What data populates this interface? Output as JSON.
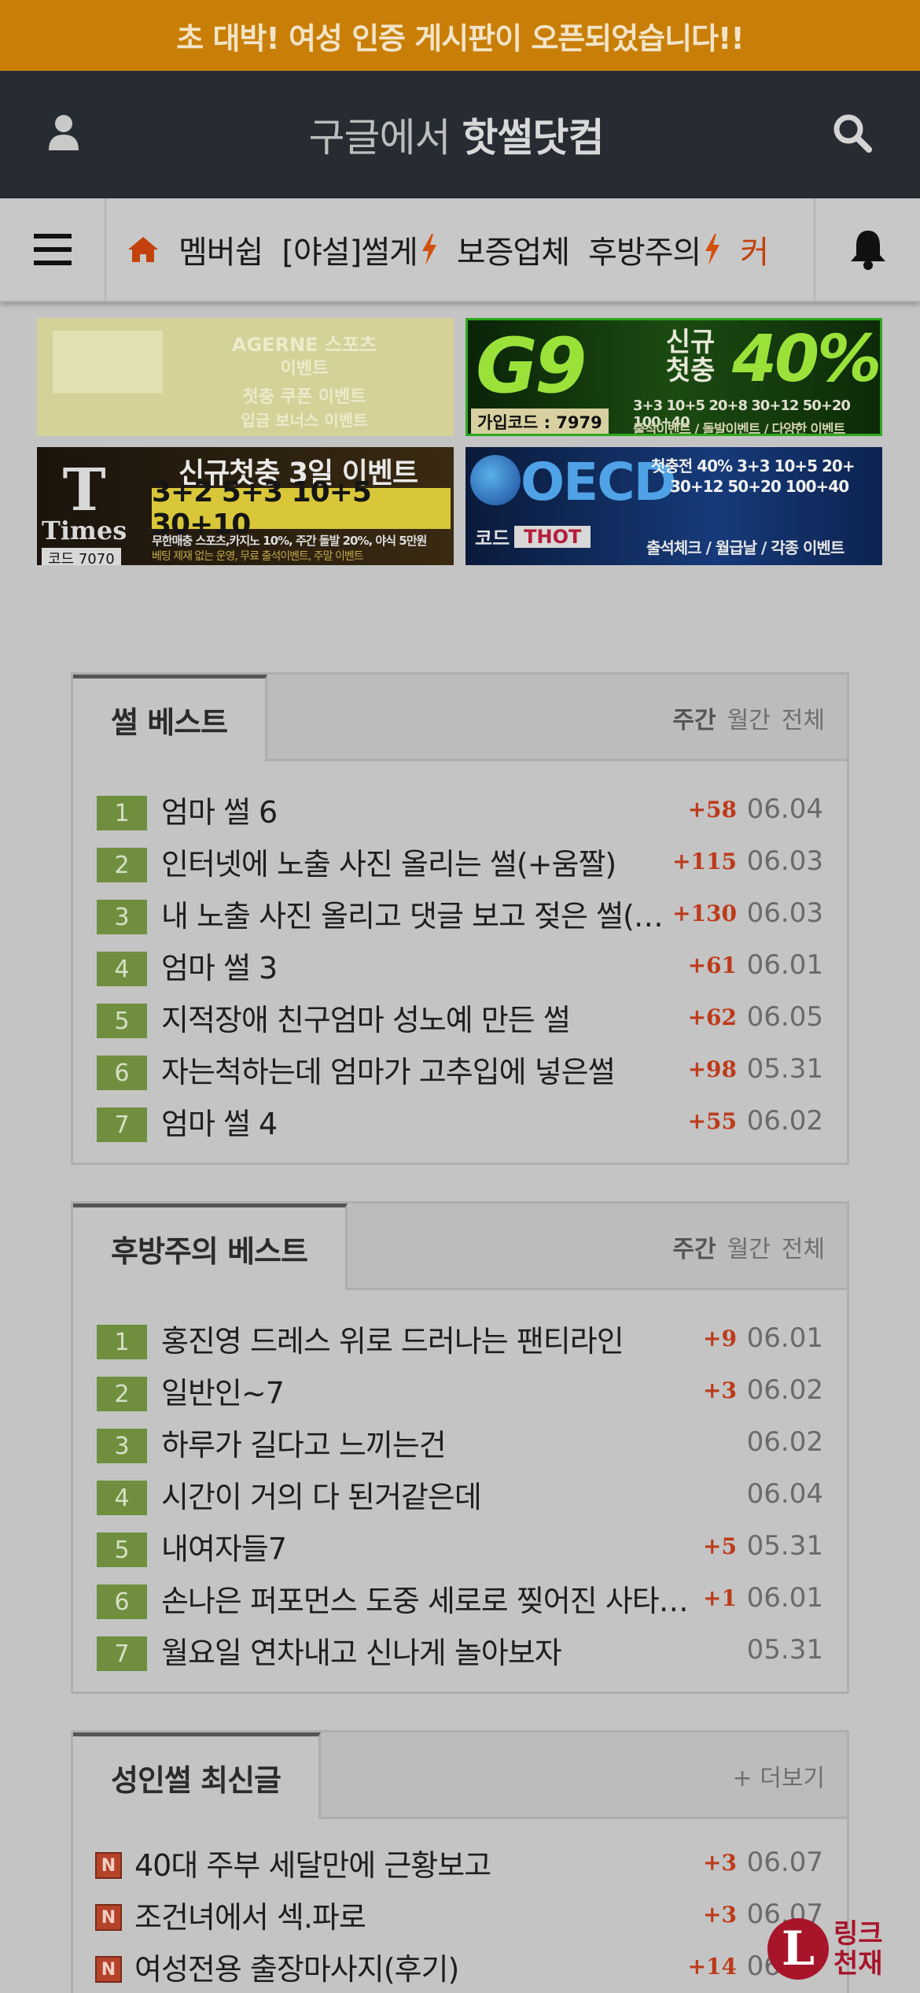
{
  "top_banner": "초 대박! 여성 인증 게시판이 오픈되었습니다!!",
  "header": {
    "title_prefix": "구글에서 ",
    "title_bold": "핫썰닷컴"
  },
  "nav": {
    "items": [
      "멤버쉽",
      "[야설]썰게",
      "보증업체",
      "후방주의",
      "커"
    ]
  },
  "banners": {
    "b1": {
      "text1": "AGERNE 스포츠",
      "text2": "이벤트",
      "text3": "첫충 쿠폰 이벤트",
      "text4": "입금 보너스 이벤트"
    },
    "b2": {
      "brand": "G9",
      "promo": "신규 첫충",
      "percent": "40%",
      "code": "가입코드 : 7979",
      "tiers": "3+3 10+5 20+8 30+12 50+20 100+40",
      "events": "출석이벤트 / 돌발이벤트 / 다양한 이벤트"
    },
    "b3": {
      "brand": "Times",
      "headline": "신규첫충 3일 이벤트",
      "tiers": "3+2 5+3 10+5 30+10",
      "code": "코드 7070",
      "detail": "무한매충 스포츠,카지노 10%, 주간 돌발 20%, 야식 5만원",
      "detail2": "베팅 제재 없는 운영, 무료 출석이벤트, 주말 이벤트"
    },
    "b4": {
      "brand": "OECD",
      "code_label": "코드",
      "code": "THOT",
      "tiers": "첫충전 40% 3+3 10+5 20+",
      "tiers2": "30+12 50+20 100+40",
      "events": "출석체크 / 월급날 / 각종 이벤트"
    }
  },
  "best": {
    "tab": "썰 베스트",
    "period": [
      "주간",
      "월간",
      "전체"
    ],
    "rows": [
      {
        "num": "1",
        "title": "엄마 썰 6",
        "count": "+58",
        "date": "06.04"
      },
      {
        "num": "2",
        "title": "인터넷에 노출 사진 올리는 썰(+움짤)",
        "count": "+115",
        "date": "06.03"
      },
      {
        "num": "3",
        "title": "내 노출 사진 올리고 댓글 보고 젖은 썰(+움짤)",
        "count": "+130",
        "date": "06.03"
      },
      {
        "num": "4",
        "title": "엄마 썰 3",
        "count": "+61",
        "date": "06.01"
      },
      {
        "num": "5",
        "title": "지적장애 친구엄마 성노예 만든 썰",
        "count": "+62",
        "date": "06.05"
      },
      {
        "num": "6",
        "title": "자는척하는데 엄마가 고추입에 넣은썰",
        "count": "+98",
        "date": "05.31"
      },
      {
        "num": "7",
        "title": "엄마 썰 4",
        "count": "+55",
        "date": "06.02"
      }
    ]
  },
  "rear_best": {
    "tab": "후방주의 베스트",
    "period": [
      "주간",
      "월간",
      "전체"
    ],
    "rows": [
      {
        "num": "1",
        "title": "홍진영 드레스 위로 드러나는 팬티라인",
        "count": "+9",
        "date": "06.01"
      },
      {
        "num": "2",
        "title": "일반인~7",
        "count": "+3",
        "date": "06.02"
      },
      {
        "num": "3",
        "title": "하루가 길다고 느끼는건",
        "count": "",
        "date": "06.02"
      },
      {
        "num": "4",
        "title": "시간이 거의 다 된거같은데",
        "count": "",
        "date": "06.04"
      },
      {
        "num": "5",
        "title": "내여자들7",
        "count": "+5",
        "date": "05.31"
      },
      {
        "num": "6",
        "title": "손나은 퍼포먼스 도중 세로로 찢어진 사타구니",
        "count": "+1",
        "date": "06.01"
      },
      {
        "num": "7",
        "title": "월요일 연차내고 신나게 놀아보자",
        "count": "",
        "date": "05.31"
      }
    ]
  },
  "latest": {
    "tab": "성인썰 최신글",
    "more": "+ 더보기",
    "rows": [
      {
        "badge": "N",
        "title": "40대 주부 세달만에 근황보고",
        "count": "+3",
        "date": "06.07"
      },
      {
        "badge": "N",
        "title": "조건녀에서 섹.파로",
        "count": "+3",
        "date": "06.07"
      },
      {
        "badge": "N",
        "title": "여성전용 출장마사지(후기)",
        "count": "+14",
        "date": "06.07"
      }
    ]
  },
  "watermark": {
    "letter": "L",
    "line1": "링크",
    "line2": "천재"
  },
  "colors": {
    "top_banner": "#c97f07",
    "header": "#262c31",
    "accent_red": "#c2410c",
    "rank_green": "#6f8f3f"
  }
}
